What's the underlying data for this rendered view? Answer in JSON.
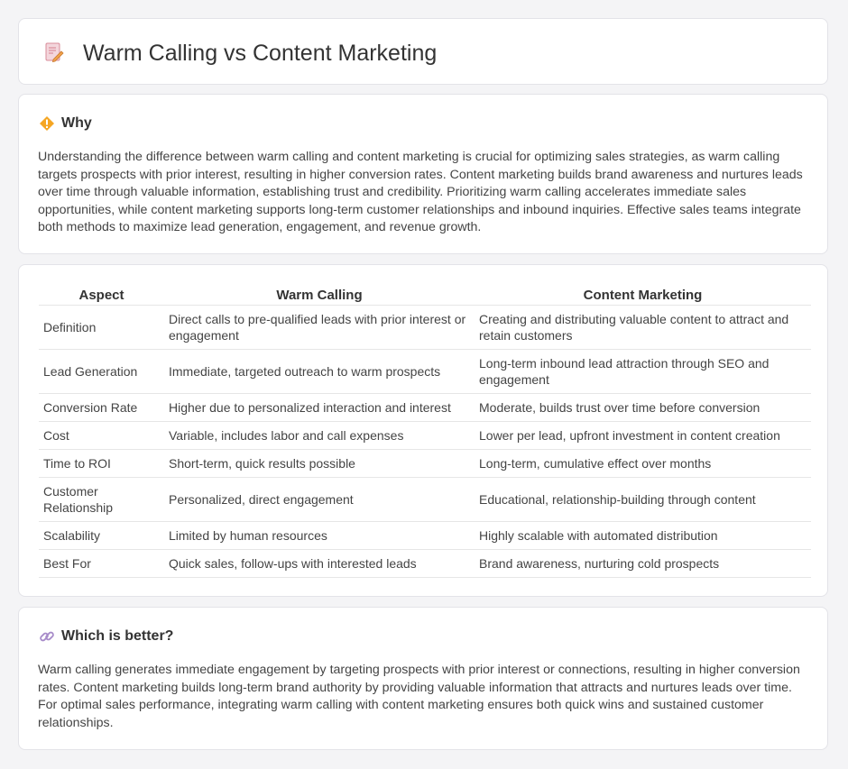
{
  "header": {
    "title": "Warm Calling vs Content Marketing",
    "icon": "document-pencil-icon"
  },
  "why": {
    "title": "Why",
    "icon": "diamond-warning-icon",
    "text": "Understanding the difference between warm calling and content marketing is crucial for optimizing sales strategies, as warm calling targets prospects with prior interest, resulting in higher conversion rates. Content marketing builds brand awareness and nurtures leads over time through valuable information, establishing trust and credibility. Prioritizing warm calling accelerates immediate sales opportunities, while content marketing supports long-term customer relationships and inbound inquiries. Effective sales teams integrate both methods to maximize lead generation, engagement, and revenue growth."
  },
  "table": {
    "headers": [
      "Aspect",
      "Warm Calling",
      "Content Marketing"
    ],
    "rows": [
      [
        "Definition",
        "Direct calls to pre-qualified leads with prior interest or engagement",
        "Creating and distributing valuable content to attract and retain customers"
      ],
      [
        "Lead Generation",
        "Immediate, targeted outreach to warm prospects",
        "Long-term inbound lead attraction through SEO and engagement"
      ],
      [
        "Conversion Rate",
        "Higher due to personalized interaction and interest",
        "Moderate, builds trust over time before conversion"
      ],
      [
        "Cost",
        "Variable, includes labor and call expenses",
        "Lower per lead, upfront investment in content creation"
      ],
      [
        "Time to ROI",
        "Short-term, quick results possible",
        "Long-term, cumulative effect over months"
      ],
      [
        "Customer Relationship",
        "Personalized, direct engagement",
        "Educational, relationship-building through content"
      ],
      [
        "Scalability",
        "Limited by human resources",
        "Highly scalable with automated distribution"
      ],
      [
        "Best For",
        "Quick sales, follow-ups with interested leads",
        "Brand awareness, nurturing cold prospects"
      ]
    ]
  },
  "better": {
    "title": "Which is better?",
    "icon": "link-icon",
    "text": "Warm calling generates immediate engagement by targeting prospects with prior interest or connections, resulting in higher conversion rates. Content marketing builds long-term brand authority by providing valuable information that attracts and nurtures leads over time. For optimal sales performance, integrating warm calling with content marketing ensures both quick wins and sustained customer relationships."
  },
  "colors": {
    "accent_orange": "#f5a623",
    "icon_pink": "#e87a8a",
    "background": "#f4f4f6"
  }
}
